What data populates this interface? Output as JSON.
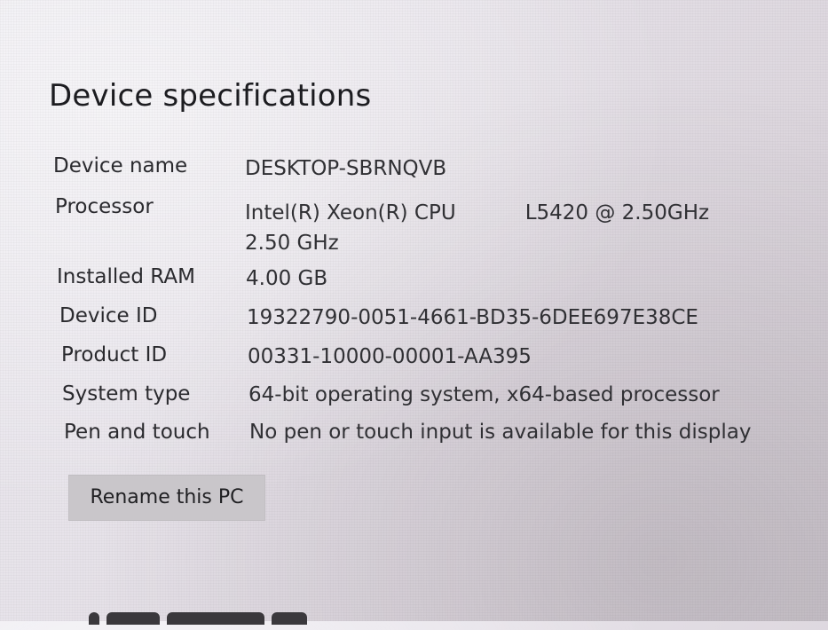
{
  "section": {
    "title": "Device specifications"
  },
  "specs": [
    {
      "label": "Device name",
      "value": "DESKTOP-SBRNQVB"
    },
    {
      "label": "Processor",
      "value_part1": "Intel(R) Xeon(R) CPU",
      "value_part2": "L5420  @ 2.50GHz",
      "value_line2": "2.50 GHz"
    },
    {
      "label": "Installed RAM",
      "value": "4.00 GB"
    },
    {
      "label": "Device ID",
      "value": "19322790-0051-4661-BD35-6DEE697E38CE"
    },
    {
      "label": "Product ID",
      "value": "00331-10000-00001-AA395"
    },
    {
      "label": "System type",
      "value": "64-bit operating system, x64-based processor"
    },
    {
      "label": "Pen and touch",
      "value": "No pen or touch input is available for this display"
    }
  ],
  "rename_button": {
    "label": "Rename this PC"
  }
}
